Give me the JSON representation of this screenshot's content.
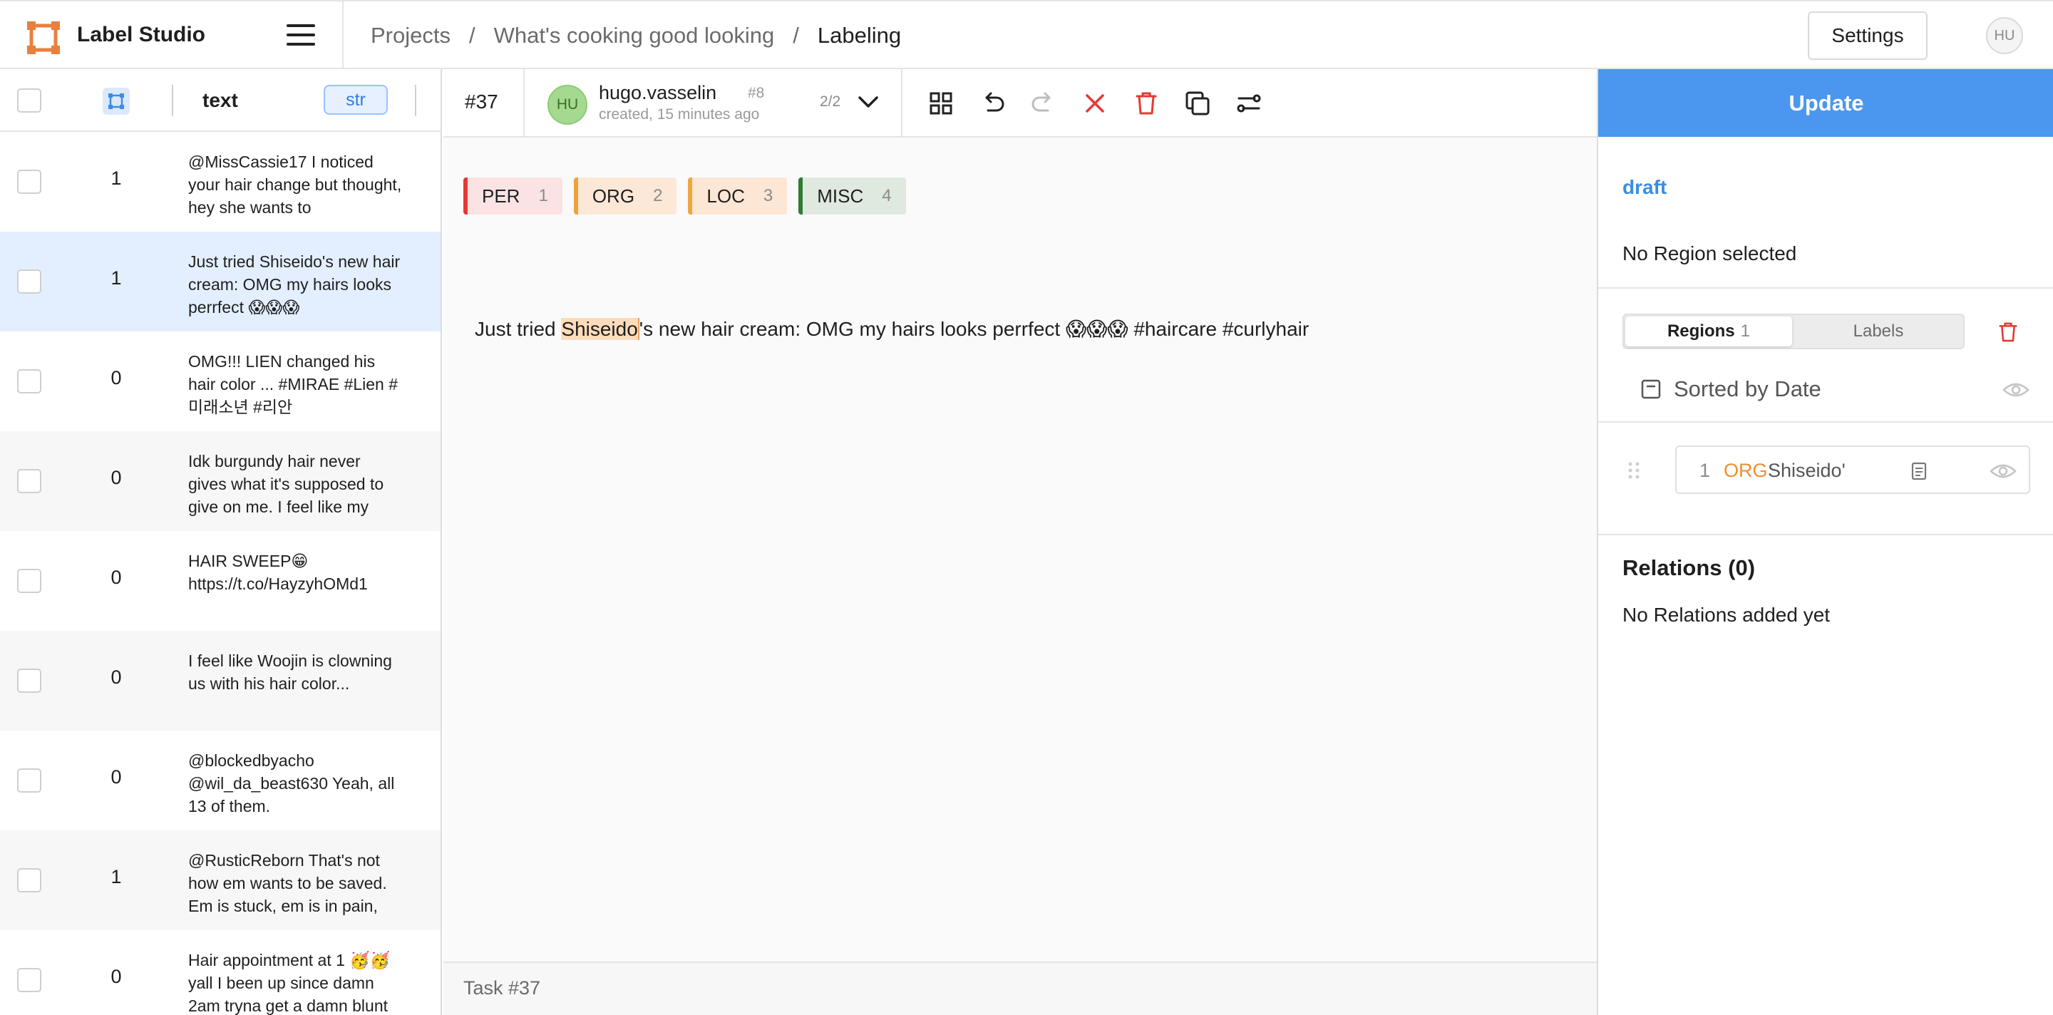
{
  "app": {
    "name": "Label Studio"
  },
  "header": {
    "breadcrumb": [
      "Projects",
      "What's cooking good looking",
      "Labeling"
    ],
    "separator": "/",
    "settings_label": "Settings",
    "user_initials": "HU"
  },
  "table": {
    "column_text": "text",
    "column_type": "str",
    "rows": [
      {
        "value": "1",
        "text": "@MissCassie17 I noticed your hair change but thought, hey she wants to",
        "selected": false
      },
      {
        "value": "1",
        "text": "Just tried Shiseido's new hair cream: OMG my hairs looks perrfect 😱😱😱",
        "selected": true
      },
      {
        "value": "0",
        "text": "OMG!!! LIEN changed his hair color ... #MIRAE #Lien #미래소년 #리안",
        "selected": false
      },
      {
        "value": "0",
        "text": "Idk burgundy hair never gives what it's supposed to give on me. I feel like my",
        "selected": false
      },
      {
        "value": "0",
        "text": "HAIR SWEEP😁 https://t.co/HayzyhOMd1",
        "selected": false
      },
      {
        "value": "0",
        "text": "I feel like Woojin is clowning us with his hair color...",
        "selected": false
      },
      {
        "value": "0",
        "text": "@blockedbyacho @wil_da_beast630 Yeah, all 13 of them.",
        "selected": false
      },
      {
        "value": "1",
        "text": "@RusticReborn That's not how em wants to be saved. Em is stuck, em is in pain,",
        "selected": false
      },
      {
        "value": "0",
        "text": "Hair appointment at 1 🥳🥳 yall I been up since damn 2am tryna get a damn blunt",
        "selected": false
      }
    ]
  },
  "annotation": {
    "task_id": "#37",
    "user_initials": "HU",
    "username": "hugo.vasselin",
    "annotation_id": "#8",
    "created": "created, 15 minutes ago",
    "pager": "2/2"
  },
  "labels": [
    {
      "name": "PER",
      "key": "1",
      "color": "#e53935",
      "bg": "#fbe3e3"
    },
    {
      "name": "ORG",
      "key": "2",
      "color": "#f2a03d",
      "bg": "#fde8d8"
    },
    {
      "name": "LOC",
      "key": "3",
      "color": "#f0a640",
      "bg": "#fde6d4"
    },
    {
      "name": "MISC",
      "key": "4",
      "color": "#2e7d32",
      "bg": "#dfe9df"
    }
  ],
  "text": {
    "before": "Just tried ",
    "highlight": "Shiseido",
    "after": "'s new hair cream: OMG my hairs looks perrfect 😱😱😱 #haircare #curlyhair"
  },
  "footer": {
    "task_label": "Task #37"
  },
  "side": {
    "update_label": "Update",
    "draft_label": "draft",
    "no_region": "No Region selected",
    "tab_regions": "Regions",
    "tab_regions_count": "1",
    "tab_labels": "Labels",
    "sort_label": "Sorted by Date",
    "region": {
      "index": "1",
      "label": "ORG",
      "text": "Shiseido'"
    },
    "relations_title": "Relations (0)",
    "no_relations": "No Relations added yet"
  }
}
